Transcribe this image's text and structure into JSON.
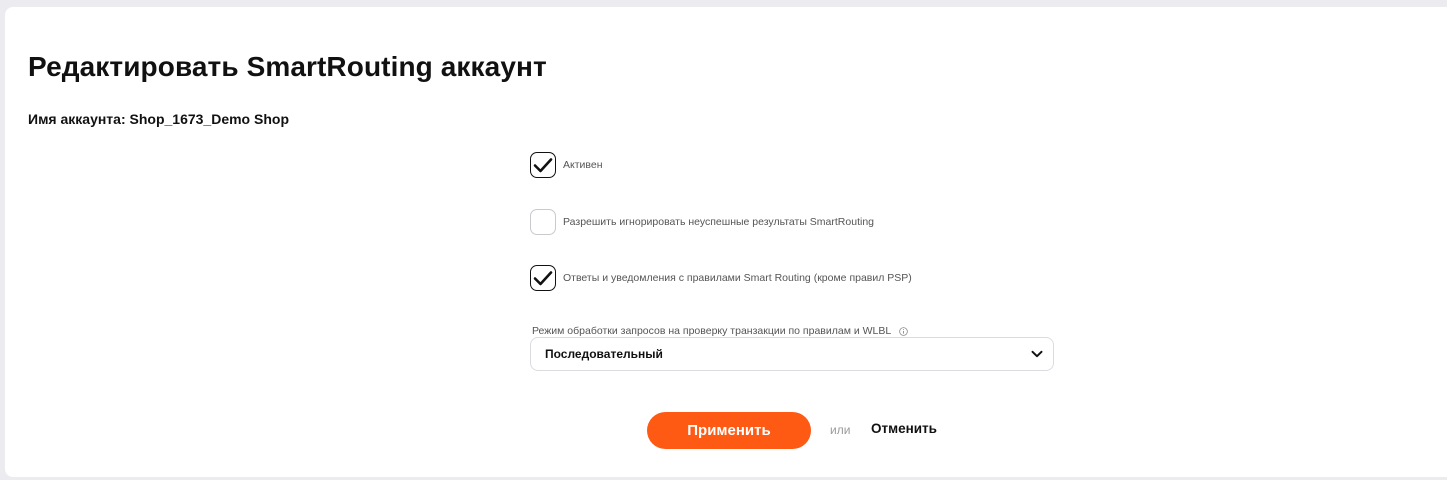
{
  "header": {
    "title": "Редактировать SmartRouting аккаунт",
    "account_name": "Имя аккаунта: Shop_1673_Demo Shop"
  },
  "options": {
    "active": {
      "label": "Активен",
      "checked": true
    },
    "ignore_failed": {
      "label": "Разрешить игнорировать неуспешные результаты SmartRouting",
      "checked": false
    },
    "replies_notifications": {
      "label": "Ответы и уведомления с правилами Smart Routing (кроме правил PSP)",
      "checked": true
    }
  },
  "mode_select": {
    "caption": "Режим обработки запросов на проверку транзакции по правилам и WLBL",
    "value": "Последовательный",
    "info_icon": "info-icon",
    "dropdown_icon": "chevron-down-icon"
  },
  "actions": {
    "apply_label": "Применить",
    "or_label": "или",
    "cancel_label": "Отменить"
  },
  "colors": {
    "accent": "#ff5a14",
    "background": "#ececf0",
    "card": "#ffffff",
    "text": "#111111",
    "muted_text": "#555555"
  }
}
